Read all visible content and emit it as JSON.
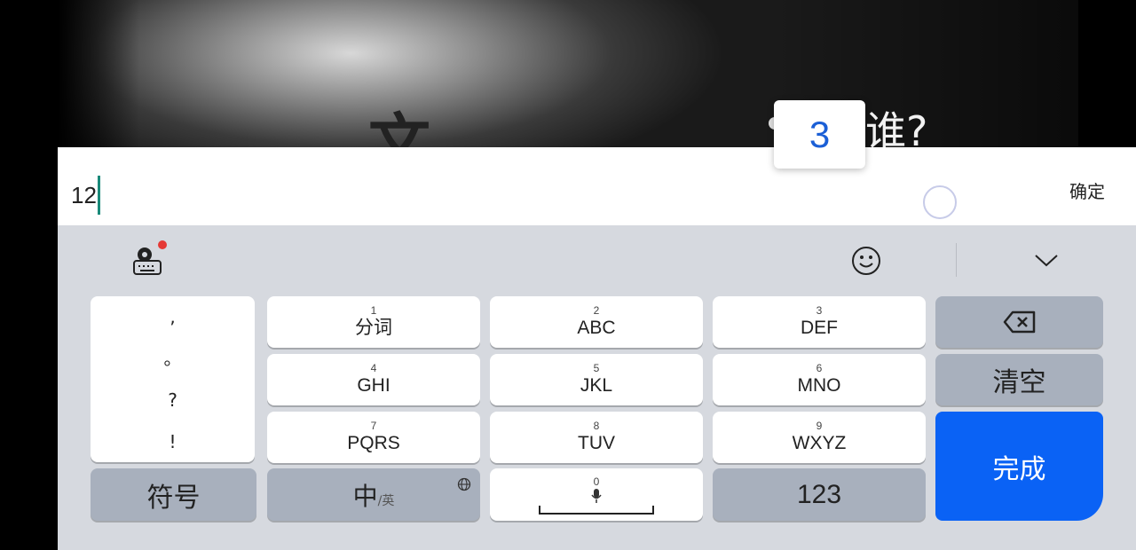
{
  "video": {
    "subtitle_text": "谁?"
  },
  "input": {
    "value": "12",
    "confirm_label": "确定"
  },
  "candidate": {
    "text": "3"
  },
  "keyboard": {
    "punctuation": [
      ",",
      "。",
      "?",
      "!"
    ],
    "keys": [
      {
        "num": "1",
        "label": "分词"
      },
      {
        "num": "2",
        "label": "ABC"
      },
      {
        "num": "3",
        "label": "DEF"
      },
      {
        "num": "4",
        "label": "GHI"
      },
      {
        "num": "5",
        "label": "JKL"
      },
      {
        "num": "6",
        "label": "MNO"
      },
      {
        "num": "7",
        "label": "PQRS"
      },
      {
        "num": "8",
        "label": "TUV"
      },
      {
        "num": "9",
        "label": "WXYZ"
      }
    ],
    "clear_label": "清空",
    "done_label": "完成",
    "symbol_label": "符号",
    "lang_main": "中",
    "lang_sub": "/英",
    "zero_num": "0",
    "numeric_label": "123"
  },
  "colors": {
    "accent": "#0a62f5",
    "keyboard_bg": "#d6d9df",
    "function_key": "#a8b0bd",
    "candidate_text": "#1b5fd6"
  },
  "icons": [
    "keyboard-settings-icon",
    "emoji-icon",
    "collapse-chevron-icon",
    "backspace-icon",
    "globe-icon",
    "microphone-icon"
  ]
}
